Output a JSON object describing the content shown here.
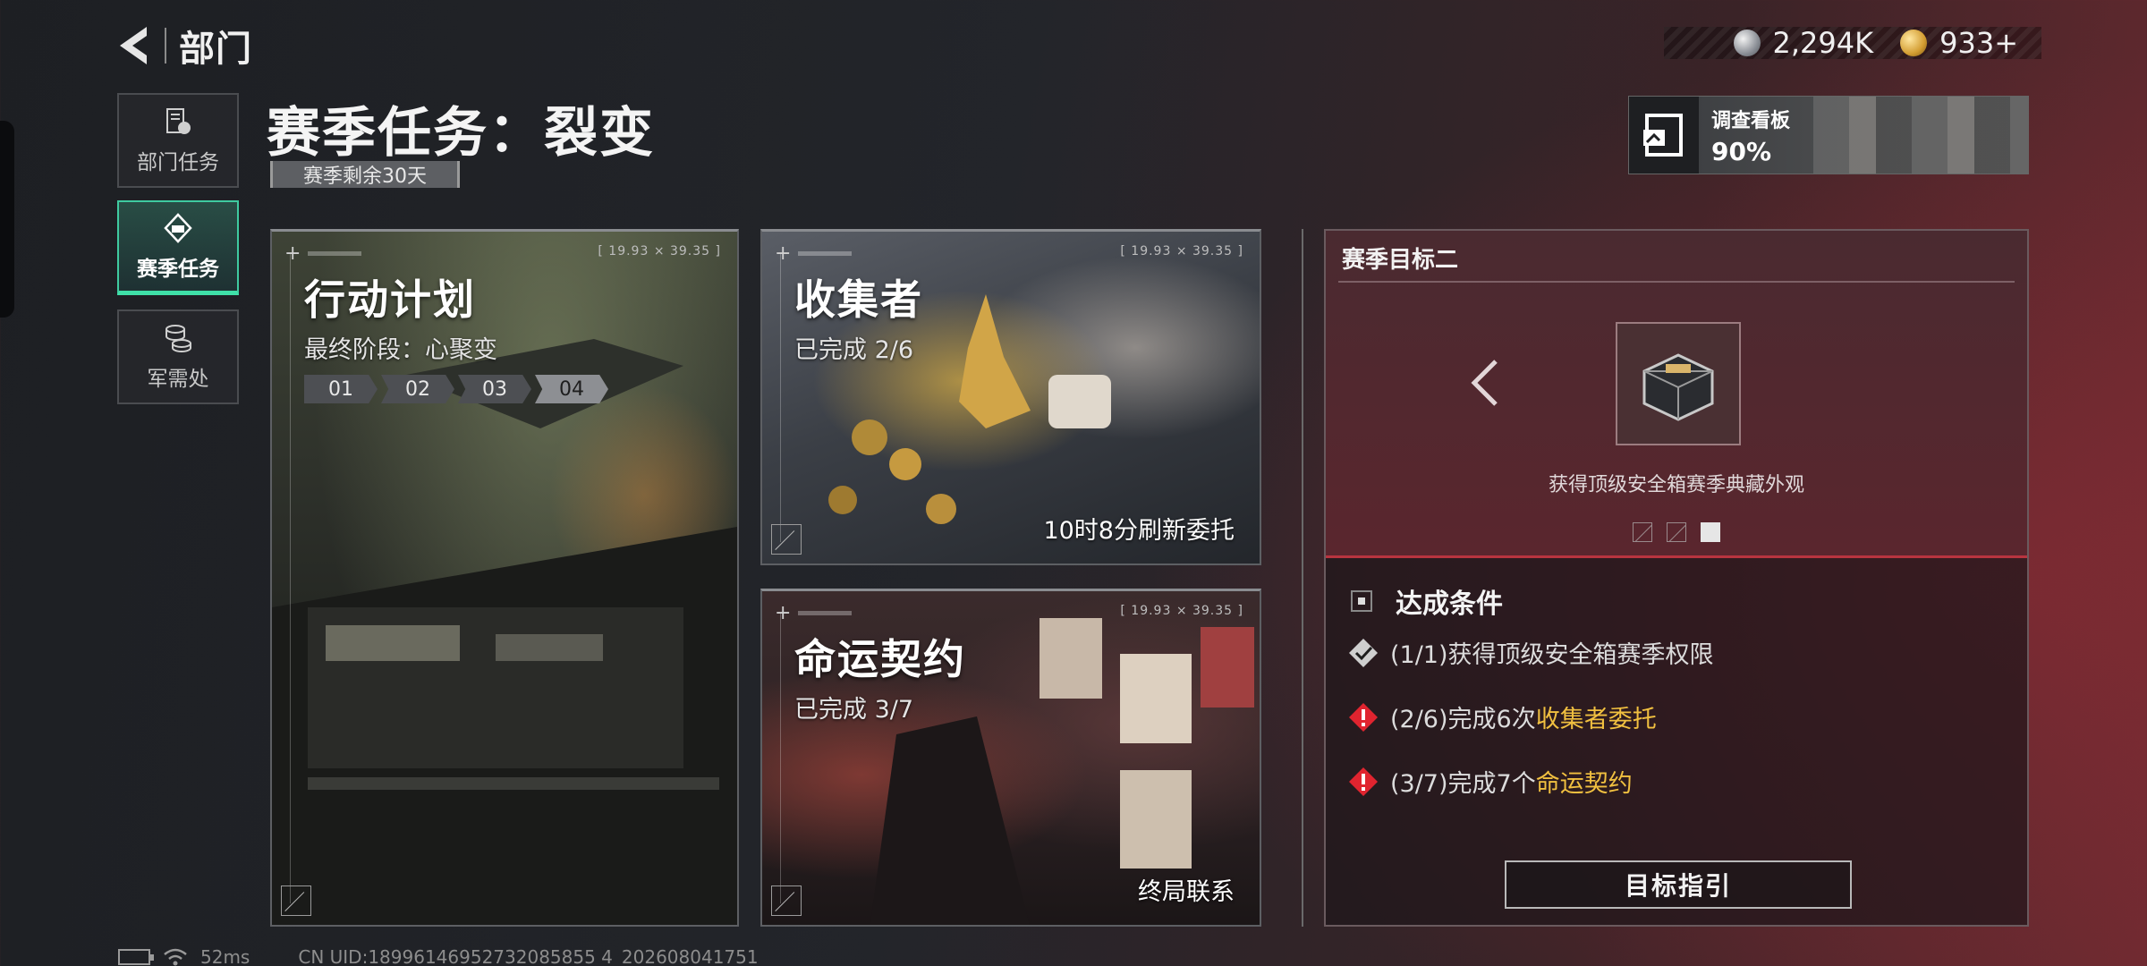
{
  "header": {
    "back_label": "部门",
    "currency": [
      {
        "icon": "silver-coin-icon",
        "value": "2,294K"
      },
      {
        "icon": "gold-coin-icon",
        "value": "933+"
      }
    ]
  },
  "sidebar": {
    "items": [
      {
        "label": "部门任务",
        "icon": "department-mission-icon",
        "active": false
      },
      {
        "label": "赛季任务",
        "icon": "season-mission-icon",
        "active": true
      },
      {
        "label": "军需处",
        "icon": "quartermaster-icon",
        "active": false
      }
    ]
  },
  "page": {
    "title": "赛季任务：裂变",
    "season_remaining": "赛季剩余30天"
  },
  "board": {
    "label": "调查看板",
    "percent": "90%"
  },
  "cards": {
    "plan": {
      "title": "行动计划",
      "subtitle": "最终阶段：心聚变",
      "coord": "[ 19.93 × 39.35 ]",
      "stages": [
        "01",
        "02",
        "03",
        "04"
      ],
      "active_stage": 4
    },
    "collector": {
      "title": "收集者",
      "subtitle": "已完成 2/6",
      "coord": "[ 19.93 × 39.35 ]",
      "footer": "10时8分刷新委托"
    },
    "fate": {
      "title": "命运契约",
      "subtitle": "已完成 3/7",
      "coord": "[ 19.93 × 39.35 ]",
      "footer": "终局联系"
    }
  },
  "goal": {
    "heading": "赛季目标二",
    "reward_desc": "获得顶级安全箱赛季典藏外观",
    "pager_total": 3,
    "pager_active": 3,
    "conditions_title": "达成条件",
    "conditions": [
      {
        "status": "done",
        "prefix": "(1/1)获得顶级安全箱赛季权限",
        "highlight": ""
      },
      {
        "status": "warn",
        "prefix": "(2/6)完成6次",
        "highlight": "收集者委托"
      },
      {
        "status": "warn",
        "prefix": "(3/7)完成7个",
        "highlight": "命运契约"
      }
    ],
    "button_label": "目标指引"
  },
  "footer": {
    "ping": "52ms",
    "uid": "CN UID:18996146952732085855 4_202608041751"
  },
  "colors": {
    "accent_green": "#3fe0a8",
    "highlight_yellow": "#f1c040",
    "warn_red": "#e0242f",
    "panel_red": "#b8343f"
  }
}
